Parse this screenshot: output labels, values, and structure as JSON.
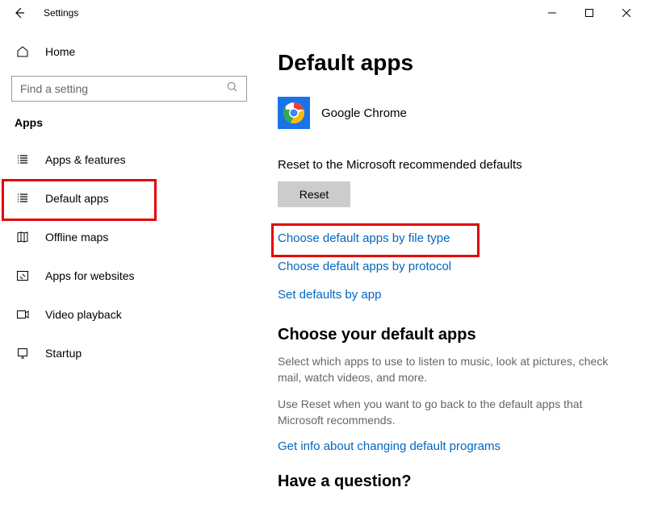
{
  "window": {
    "title": "Settings"
  },
  "sidebar": {
    "home": "Home",
    "search_placeholder": "Find a setting",
    "section_label": "Apps",
    "items": [
      {
        "label": "Apps & features"
      },
      {
        "label": "Default apps"
      },
      {
        "label": "Offline maps"
      },
      {
        "label": "Apps for websites"
      },
      {
        "label": "Video playback"
      },
      {
        "label": "Startup"
      }
    ]
  },
  "main": {
    "title": "Default apps",
    "current_app": "Google Chrome",
    "reset_label": "Reset to the Microsoft recommended defaults",
    "reset_button": "Reset",
    "links": {
      "by_file_type": "Choose default apps by file type",
      "by_protocol": "Choose default apps by protocol",
      "by_app": "Set defaults by app"
    },
    "choose_heading": "Choose your default apps",
    "choose_body1": "Select which apps to use to listen to music, look at pictures, check mail, watch videos, and more.",
    "choose_body2": "Use Reset when you want to go back to the default apps that Microsoft recommends.",
    "info_link": "Get info about changing default programs",
    "question_heading": "Have a question?"
  }
}
